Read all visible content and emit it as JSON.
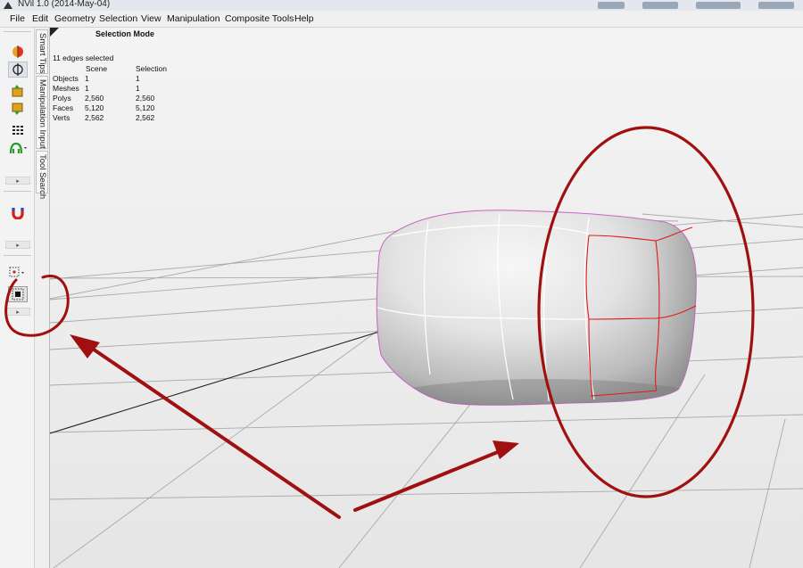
{
  "window": {
    "title": "NVil 1.0 (2014-May-04)"
  },
  "menu": [
    "File",
    "Edit",
    "Geometry",
    "Selection",
    "View",
    "Manipulation",
    "Composite Tools",
    "Help"
  ],
  "side_tabs": [
    "Smart Tips",
    "Manipulation Input",
    "Tool Search"
  ],
  "toolbar": {
    "icons": [
      "symmetry-color-icon",
      "mirror-axis-icon",
      "box-up-icon",
      "box-down-icon",
      "grid-dots-icon",
      "character-icon",
      "magnet-icon",
      "selection-dots-icon",
      "box-select-icon"
    ],
    "expand_glyph": "▸"
  },
  "viewport": {
    "mode_label": "Selection Mode",
    "selection_summary": "11 edges selected",
    "stats_headers": [
      "Scene",
      "Selection"
    ],
    "stats": [
      {
        "label": "Objects",
        "scene": "1",
        "selection": "1"
      },
      {
        "label": "Meshes",
        "scene": "1",
        "selection": "1"
      },
      {
        "label": "Polys",
        "scene": "2,560",
        "selection": "2,560"
      },
      {
        "label": "Faces",
        "scene": "5,120",
        "selection": "5,120"
      },
      {
        "label": "Verts",
        "scene": "2,562",
        "selection": "2,562"
      }
    ]
  },
  "colors": {
    "annotation": "#a01010",
    "selected_edge": "#e21a1a",
    "wire": "#ffffff"
  }
}
